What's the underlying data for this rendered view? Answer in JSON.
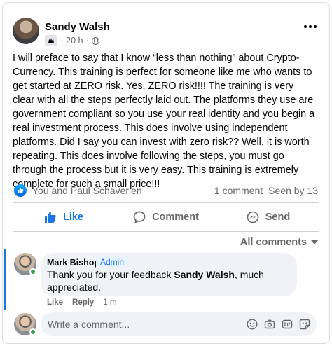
{
  "post": {
    "author": "Sandy Walsh",
    "time": "20 h",
    "separator": "·",
    "text": "I will preface to say that I know “less than nothing” about Crypto-Currency. This training is perfect for someone like me who wants to get started at ZERO risk. Yes, ZERO risk!!!! The training is very clear with all the steps perfectly laid out. The platforms they use are government compliant so you use your real identity and you begin a real investment process. This does involve using independent platforms. Did I say you can invest with zero risk?? Well, it is worth repeating. This does involve following the steps, you must go through the process but it is very easy. This training is extremely complete for such a small price!!!"
  },
  "reactions": {
    "who": "You and Paul Schaverien",
    "comments_count": "1 comment",
    "seen_by": "Seen by 13"
  },
  "actions": {
    "like": "Like",
    "comment": "Comment",
    "send": "Send"
  },
  "all_comments_label": "All comments",
  "comment": {
    "author": "Mark Bishop",
    "badge": "Admin",
    "text_before": "Thank you for your feedback ",
    "mention": "Sandy Walsh",
    "text_after": ", much appreciated.",
    "like": "Like",
    "reply": "Reply",
    "time": "1 m"
  },
  "composer": {
    "placeholder": "Write a comment..."
  },
  "colors": {
    "accent": "#1b74e4",
    "online": "#31a24c"
  },
  "icons": [
    "group-icon",
    "globe-icon",
    "more-icon",
    "like-reaction-icon",
    "thumbs-up-icon",
    "comment-icon",
    "messenger-icon",
    "caret-down-icon",
    "emoji-icon",
    "camera-icon",
    "gif-icon",
    "sticker-icon"
  ]
}
